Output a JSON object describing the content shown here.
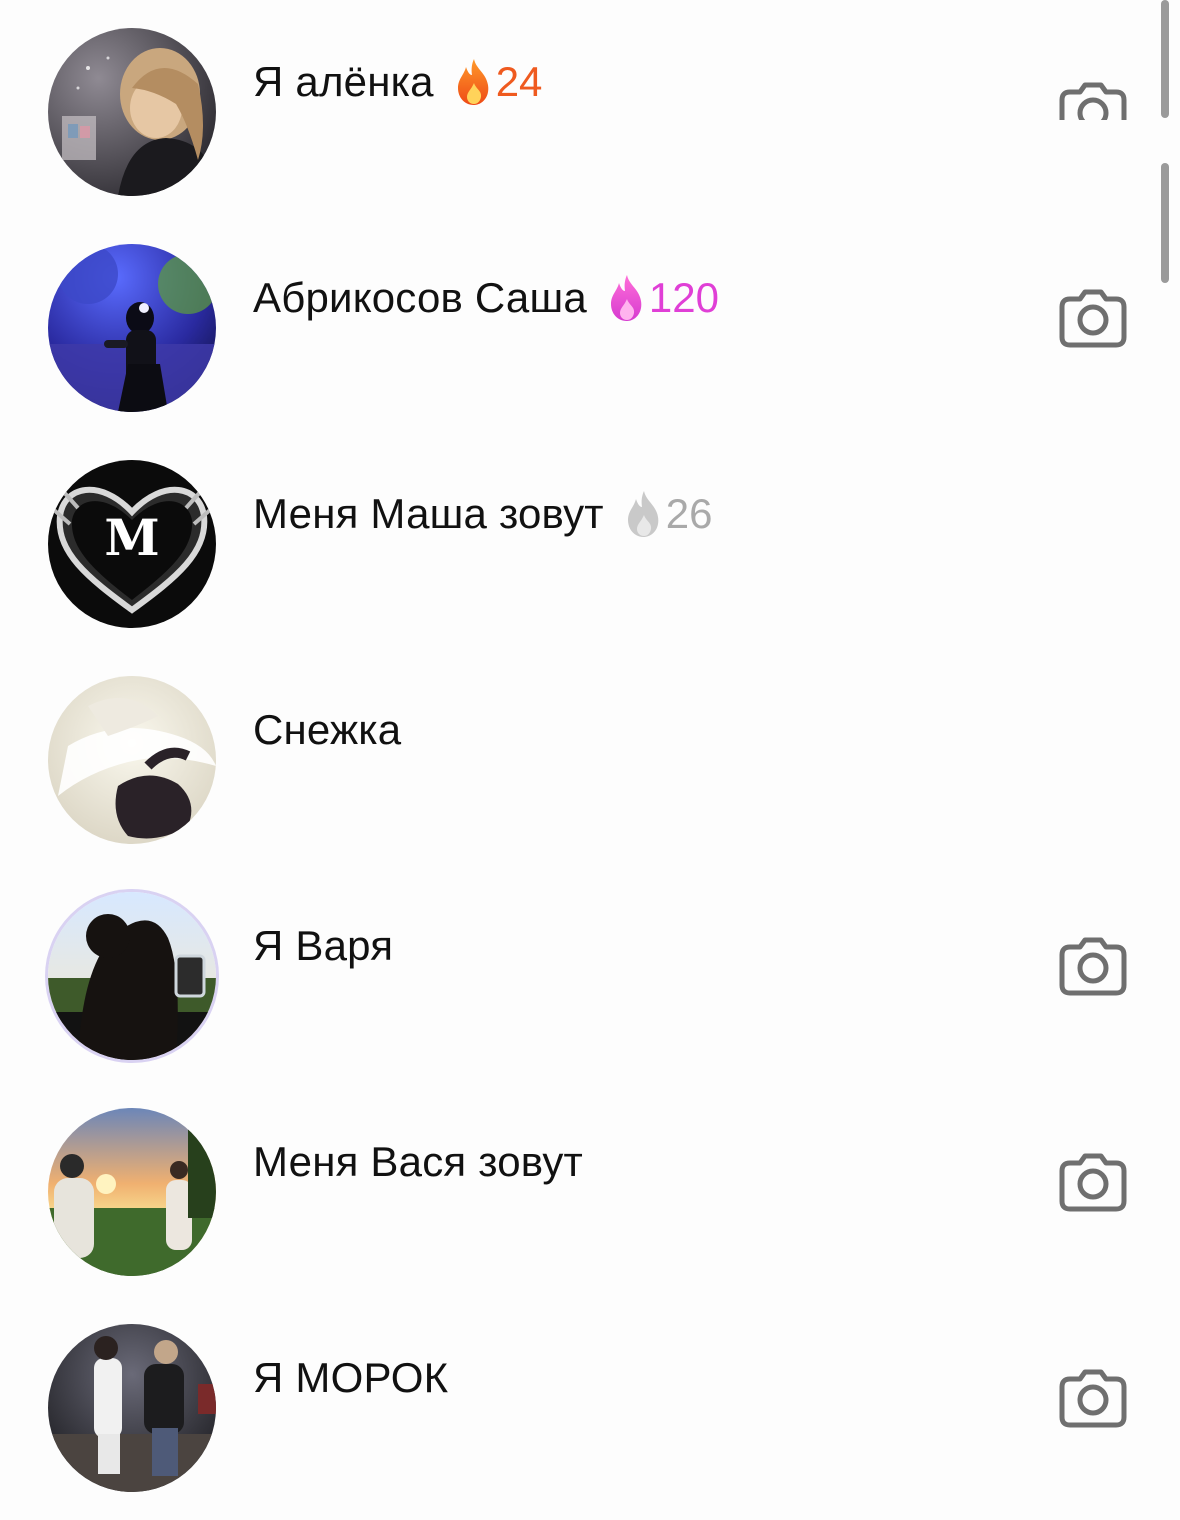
{
  "chats": [
    {
      "name": "Я алёнка",
      "streak": "24",
      "streak_color": "#ef5a1f",
      "streak_icon": "fire-icon",
      "has_camera": true,
      "avatar": "photo-girl-blonde"
    },
    {
      "name": "Абрикосов Саша",
      "streak": "120",
      "streak_color": "#e03fd6",
      "streak_icon": "fire-icon",
      "has_camera": true,
      "avatar": "photo-night-mirror-selfie"
    },
    {
      "name": "Меня Маша зовут",
      "streak": "26",
      "streak_color": "#a9a9a9",
      "streak_icon": "fire-icon",
      "has_camera": false,
      "avatar": "xray-heart-hands",
      "avatar_letter": "M"
    },
    {
      "name": "Снежка",
      "streak": "",
      "has_camera": false,
      "avatar": "white-hair-photo"
    },
    {
      "name": "Я Варя",
      "streak": "",
      "has_camera": true,
      "avatar": "dog-silhouette-photo"
    },
    {
      "name": "Меня Вася зовут",
      "streak": "",
      "has_camera": true,
      "avatar": "sunset-field-photo"
    },
    {
      "name": "Я МОРОК",
      "streak": "",
      "has_camera": true,
      "avatar": "night-street-photo"
    }
  ],
  "colors": {
    "background": "#fdfdfd",
    "text": "#111111",
    "camera_icon": "#6f6f6f"
  },
  "icons": {
    "camera": "camera-icon",
    "streak": "fire-icon"
  }
}
